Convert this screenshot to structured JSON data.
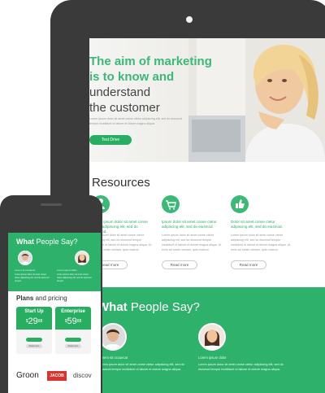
{
  "tablet": {
    "hero": {
      "headline_green_1": "The aim of marketing",
      "headline_green_2": "is to know and",
      "headline_dark_1": "understand",
      "headline_dark_2": "the customer",
      "body": "Lorem ipsum dolor sit amet conse ctetur adipiscing elit, sed do eiusmod tempor incididunt ut labore et dolore magna aliqua.",
      "button": "Test Drive"
    },
    "resources": {
      "title": "Resources",
      "items": [
        {
          "icon": "user-icon",
          "title": "Lorem ipsum dolor sit amet conse ctetur adipiscing elit, sed do eiusmod.",
          "text": "Lorem ipsum dolor sit amet conse ctetur adipiscing elit, sed do eiusmod tempor incididunt ut labore et dolore magna aliqua. Ut enim ad minim veniam, quis nostrud.",
          "button": "Read more"
        },
        {
          "icon": "cart-icon",
          "title": "Ipsum dolor sit amet conse ctetur adipiscing elit, sed do eiusmod.",
          "text": "Lorem ipsum dolor sit amet conse ctetur adipiscing elit, sed do eiusmod tempor incididunt ut labore et dolore magna aliqua. Ut enim ad minim veniam, quis nostrud.",
          "button": "Read more"
        },
        {
          "icon": "thumbs-up-icon",
          "title": "Dolor sit amet conse ctetur adipiscing elit, sed do eiusmod.",
          "text": "Lorem ipsum dolor sit amet conse ctetur adipiscing elit, sed do eiusmod tempor incididunt ut labore et dolore magna aliqua. Ut enim ad minim veniam, quis nostrud.",
          "button": "Read more"
        }
      ]
    },
    "testimonials": {
      "title_bold": "What",
      "title_rest": " People Say?",
      "items": [
        {
          "name": "Lorem sit occaecat",
          "text": "Lorem ipsum dolor sit amet conse ctetur adipiscing elit, sed do eiusmod tempor incididunt ut labore et dolore magna aliqua."
        },
        {
          "name": "Lorem ipsum dolor",
          "text": "Lorem ipsum dolor sit amet conse ctetur adipiscing elit, sed do eiusmod tempor incididunt ut labore et dolore magna aliqua."
        }
      ]
    }
  },
  "phone": {
    "testimonials": {
      "title_bold": "What",
      "title_rest": " People Say?",
      "items": [
        {
          "name": "Lorem sit occaecat",
          "text": "Lorem ipsum dolor sit amet conse ctetur adipiscing elit, sed do eiusmod tempor."
        },
        {
          "name": "Lorem ipsum dolor",
          "text": "Lorem ipsum dolor sit amet conse ctetur adipiscing elit, sed do eiusmod tempor."
        }
      ]
    },
    "plans": {
      "title_bold": "Plans",
      "title_rest": " and pricing",
      "cards": [
        {
          "name": "Start Up",
          "currency": "$",
          "price": "29",
          "cents": "88",
          "button": "Read more"
        },
        {
          "name": "Enterprise",
          "currency": "$",
          "price": "59",
          "cents": "88",
          "button": "Read more"
        }
      ]
    },
    "logos": {
      "groon": "Groon",
      "jacob": "JACOB",
      "discovery": "discov"
    }
  },
  "colors": {
    "accent": "#2eb26b",
    "accent_dark": "#27ae60",
    "device": "#3a3a3a"
  }
}
